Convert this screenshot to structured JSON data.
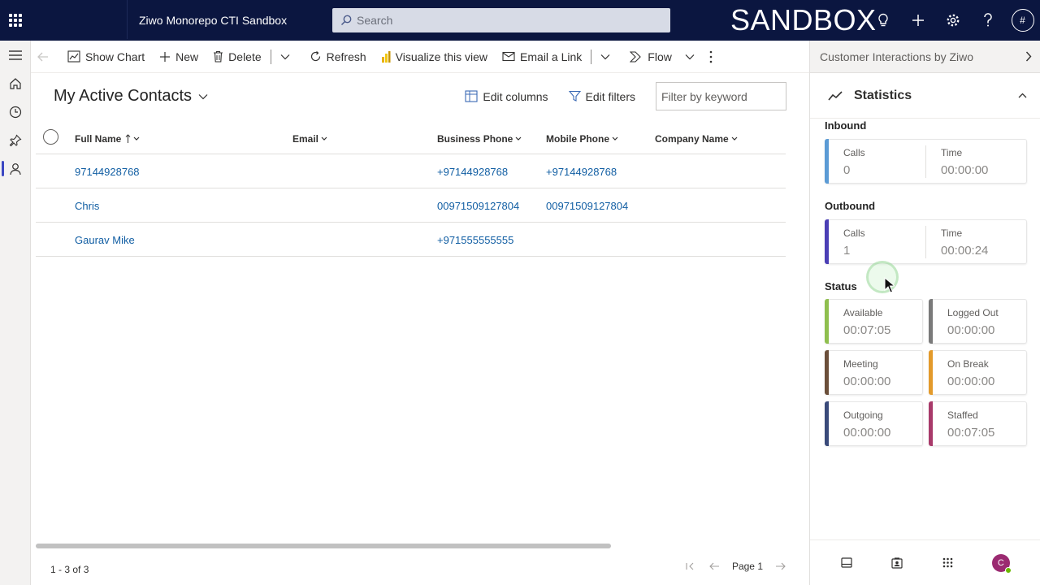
{
  "topbar": {
    "app_name": "Ziwo Monorepo CTI Sandbox",
    "search_placeholder": "Search",
    "environment": "SANDBOX",
    "user_initial": "#"
  },
  "commands": {
    "show_chart": "Show Chart",
    "new": "New",
    "delete": "Delete",
    "refresh": "Refresh",
    "visualize": "Visualize this view",
    "email_link": "Email a Link",
    "flow": "Flow"
  },
  "view": {
    "title": "My Active Contacts",
    "edit_columns": "Edit columns",
    "edit_filters": "Edit filters",
    "filter_placeholder": "Filter by keyword"
  },
  "grid": {
    "columns": [
      "Full Name",
      "Email",
      "Business Phone",
      "Mobile Phone",
      "Company Name"
    ],
    "rows": [
      [
        "97144928768",
        "",
        "+97144928768",
        "+97144928768",
        ""
      ],
      [
        "Chris",
        "",
        "00971509127804",
        "00971509127804",
        ""
      ],
      [
        "Gaurav Mike",
        "",
        "+971555555555",
        "",
        ""
      ]
    ]
  },
  "footer": {
    "count": "1 - 3 of 3",
    "page": "Page 1"
  },
  "panel": {
    "header": "Customer Interactions by Ziwo",
    "statistics_title": "Statistics",
    "inbound": {
      "label": "Inbound",
      "calls_label": "Calls",
      "calls": "0",
      "time_label": "Time",
      "time": "00:00:00"
    },
    "outbound": {
      "label": "Outbound",
      "calls_label": "Calls",
      "calls": "1",
      "time_label": "Time",
      "time": "00:00:24"
    },
    "status_label": "Status",
    "status": [
      {
        "label": "Available",
        "value": "00:07:05",
        "color": "#8fbf4e"
      },
      {
        "label": "Logged Out",
        "value": "00:00:00",
        "color": "#7a7a7a"
      },
      {
        "label": "Meeting",
        "value": "00:00:00",
        "color": "#6b4f3a"
      },
      {
        "label": "On Break",
        "value": "00:00:00",
        "color": "#e39a2b"
      },
      {
        "label": "Outgoing",
        "value": "00:00:00",
        "color": "#3a4a7a"
      },
      {
        "label": "Staffed",
        "value": "00:07:05",
        "color": "#a83a6a"
      }
    ],
    "user_initial": "C"
  },
  "colors": {
    "topbar": "#0b1640",
    "link": "#115ea3",
    "inbound_bar": "#5b9bd5",
    "outbound_bar": "#4b3fb5"
  }
}
